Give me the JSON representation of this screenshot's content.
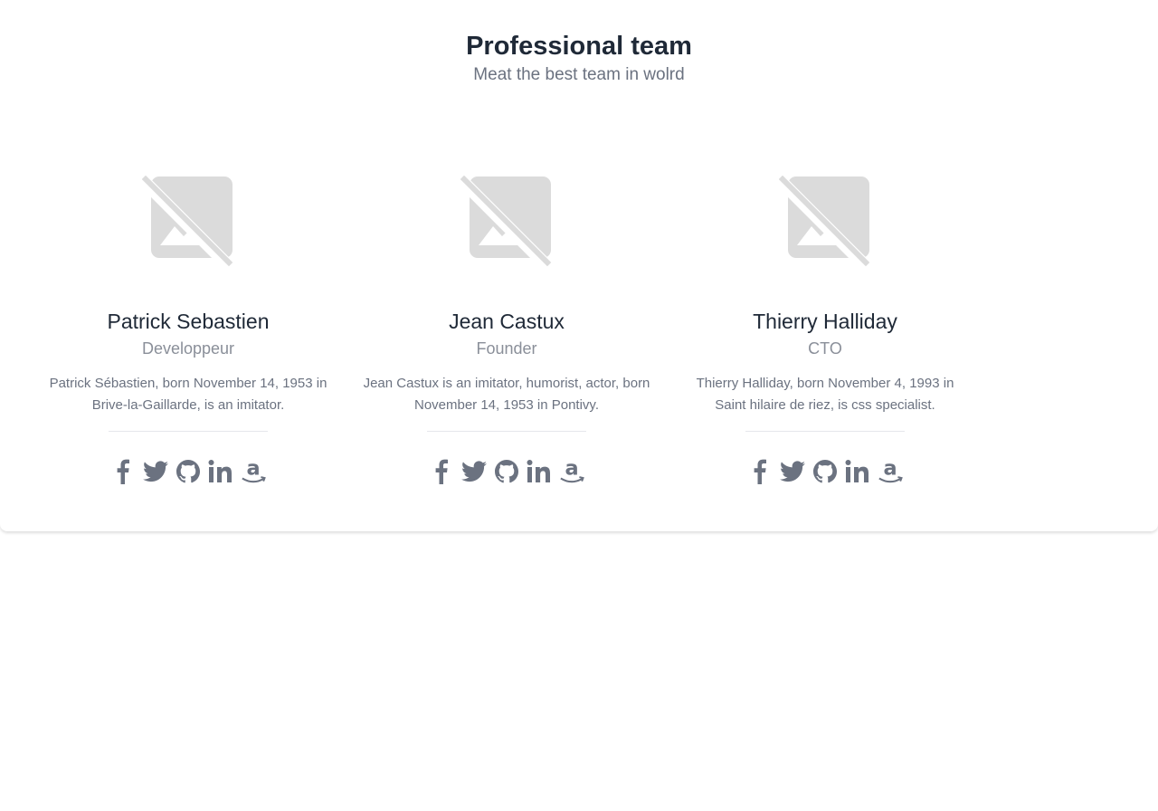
{
  "header": {
    "title": "Professional team",
    "subtitle": "Meat the best team in wolrd"
  },
  "members": [
    {
      "name": "Patrick Sebastien",
      "role": "Developpeur",
      "bio": "Patrick Sébastien, born November 14, 1953 in Brive-la-Gaillarde, is an imitator.",
      "photo_icon": "image-unavailable-icon"
    },
    {
      "name": "Jean Castux",
      "role": "Founder",
      "bio": "Jean Castux is an imitator, humorist, actor, born November 14, 1953 in Pontivy.",
      "photo_icon": "image-unavailable-icon"
    },
    {
      "name": "Thierry Halliday",
      "role": "CTO",
      "bio": "Thierry Halliday, born November 4, 1993 in Saint hilaire de riez, is css specialist.",
      "photo_icon": "image-unavailable-icon"
    }
  ],
  "social_icons": [
    "facebook-icon",
    "twitter-icon",
    "github-icon",
    "linkedin-icon",
    "amazon-icon"
  ],
  "colors": {
    "icon": "#6b7280",
    "placeholder": "#dbdbdb",
    "title": "#1f2937",
    "muted": "#6b7280"
  }
}
